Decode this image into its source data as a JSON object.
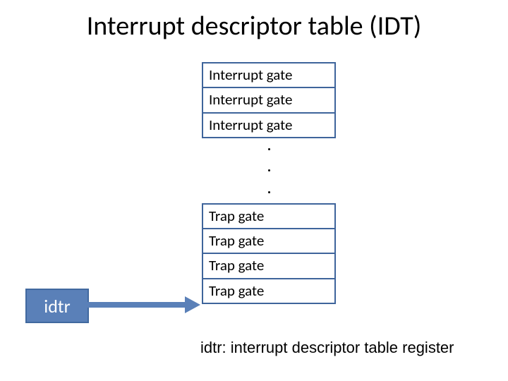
{
  "title": "Interrupt descriptor table (IDT)",
  "gates": [
    "Interrupt gate",
    "Interrupt gate",
    "Interrupt gate",
    "Trap gate",
    "Trap gate",
    "Trap gate",
    "Trap gate"
  ],
  "ellipsis_after_index": 2,
  "idtr_label": "idtr",
  "caption": "idtr: interrupt descriptor table register"
}
